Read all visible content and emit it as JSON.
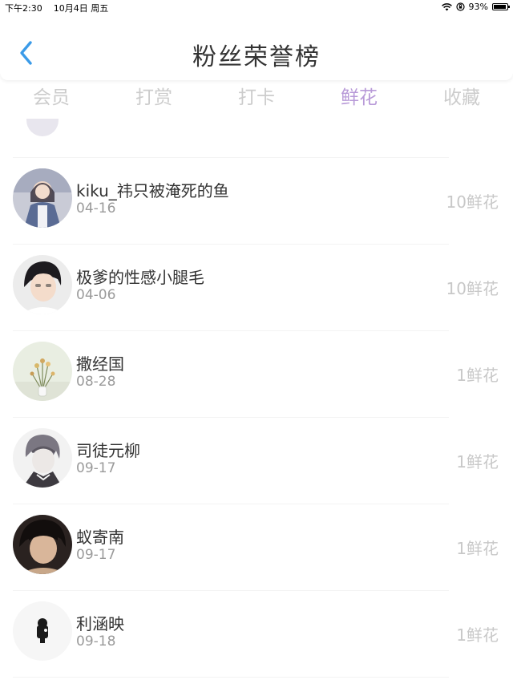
{
  "status_bar": {
    "time": "下午2:30",
    "date": "10月4日 周五",
    "battery": "93%",
    "battery_level": 0.93
  },
  "header": {
    "title": "粉丝荣誉榜"
  },
  "tabs": [
    {
      "label": "会员",
      "active": false
    },
    {
      "label": "打赏",
      "active": false
    },
    {
      "label": "打卡",
      "active": false
    },
    {
      "label": "鲜花",
      "active": true
    },
    {
      "label": "收藏",
      "active": false
    }
  ],
  "colors": {
    "accent": "#b89ad8",
    "back_icon": "#3b9be8"
  },
  "fans": [
    {
      "name": "kiku_祎只被淹死的鱼",
      "date": "04-16",
      "count": "10鲜花"
    },
    {
      "name": "极爹的性感小腿毛",
      "date": "04-06",
      "count": "10鲜花"
    },
    {
      "name": "撒经国",
      "date": "08-28",
      "count": "1鲜花"
    },
    {
      "name": "司徒元柳",
      "date": "09-17",
      "count": "1鲜花"
    },
    {
      "name": "蚁寄南",
      "date": "09-17",
      "count": "1鲜花"
    },
    {
      "name": "利涵映",
      "date": "09-18",
      "count": "1鲜花"
    }
  ]
}
